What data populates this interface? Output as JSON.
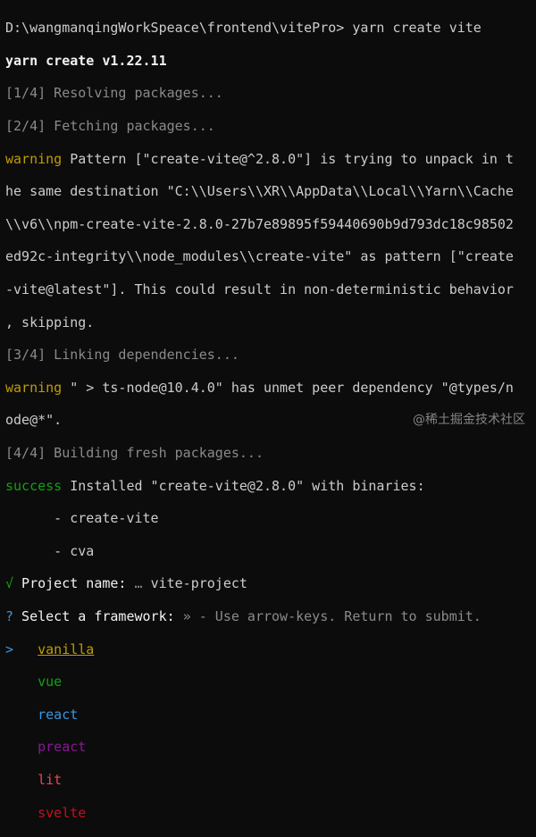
{
  "terminal": {
    "prompt_line": "D:\\wangmanqingWorkSpeace\\frontend\\vitePro> yarn create vite",
    "yarn_version": "yarn create v1.22.11",
    "step1": "[1/4] Resolving packages...",
    "step2": "[2/4] Fetching packages...",
    "warn1_tag": "warning",
    "warn1_l1": " Pattern [\"create-vite@^2.8.0\"] is trying to unpack in t",
    "warn1_l2": "he same destination \"C:\\\\Users\\\\XR\\\\AppData\\\\Local\\\\Yarn\\\\Cache",
    "warn1_l3": "\\\\v6\\\\npm-create-vite-2.8.0-27b7e89895f59440690b9d793dc18c98502",
    "warn1_l4": "ed92c-integrity\\\\node_modules\\\\create-vite\" as pattern [\"create",
    "warn1_l5": "-vite@latest\"]. This could result in non-deterministic behavior",
    "warn1_l6": ", skipping.",
    "step3": "[3/4] Linking dependencies...",
    "warn2_tag": "warning",
    "warn2_l1": " \" > ts-node@10.4.0\" has unmet peer dependency \"@types/n",
    "warn2_l2": "ode@*\".",
    "step4": "[4/4] Building fresh packages...",
    "success_tag": "success",
    "success_text": " Installed \"create-vite@2.8.0\" with binaries:",
    "bin1": "      - create-vite",
    "bin2": "      - cva",
    "project_check": "√",
    "project_label": " Project name: ",
    "project_ellipsis": "… ",
    "project_value": "vite-project",
    "framework_q": "?",
    "framework_label": " Select a framework: ",
    "framework_hint": "» - Use arrow-keys. Return to submit.",
    "cursor": ">",
    "options": [
      "vanilla",
      "vue",
      "react",
      "preact",
      "lit",
      "svelte"
    ]
  },
  "watermark": "@稀土掘金技术社区"
}
